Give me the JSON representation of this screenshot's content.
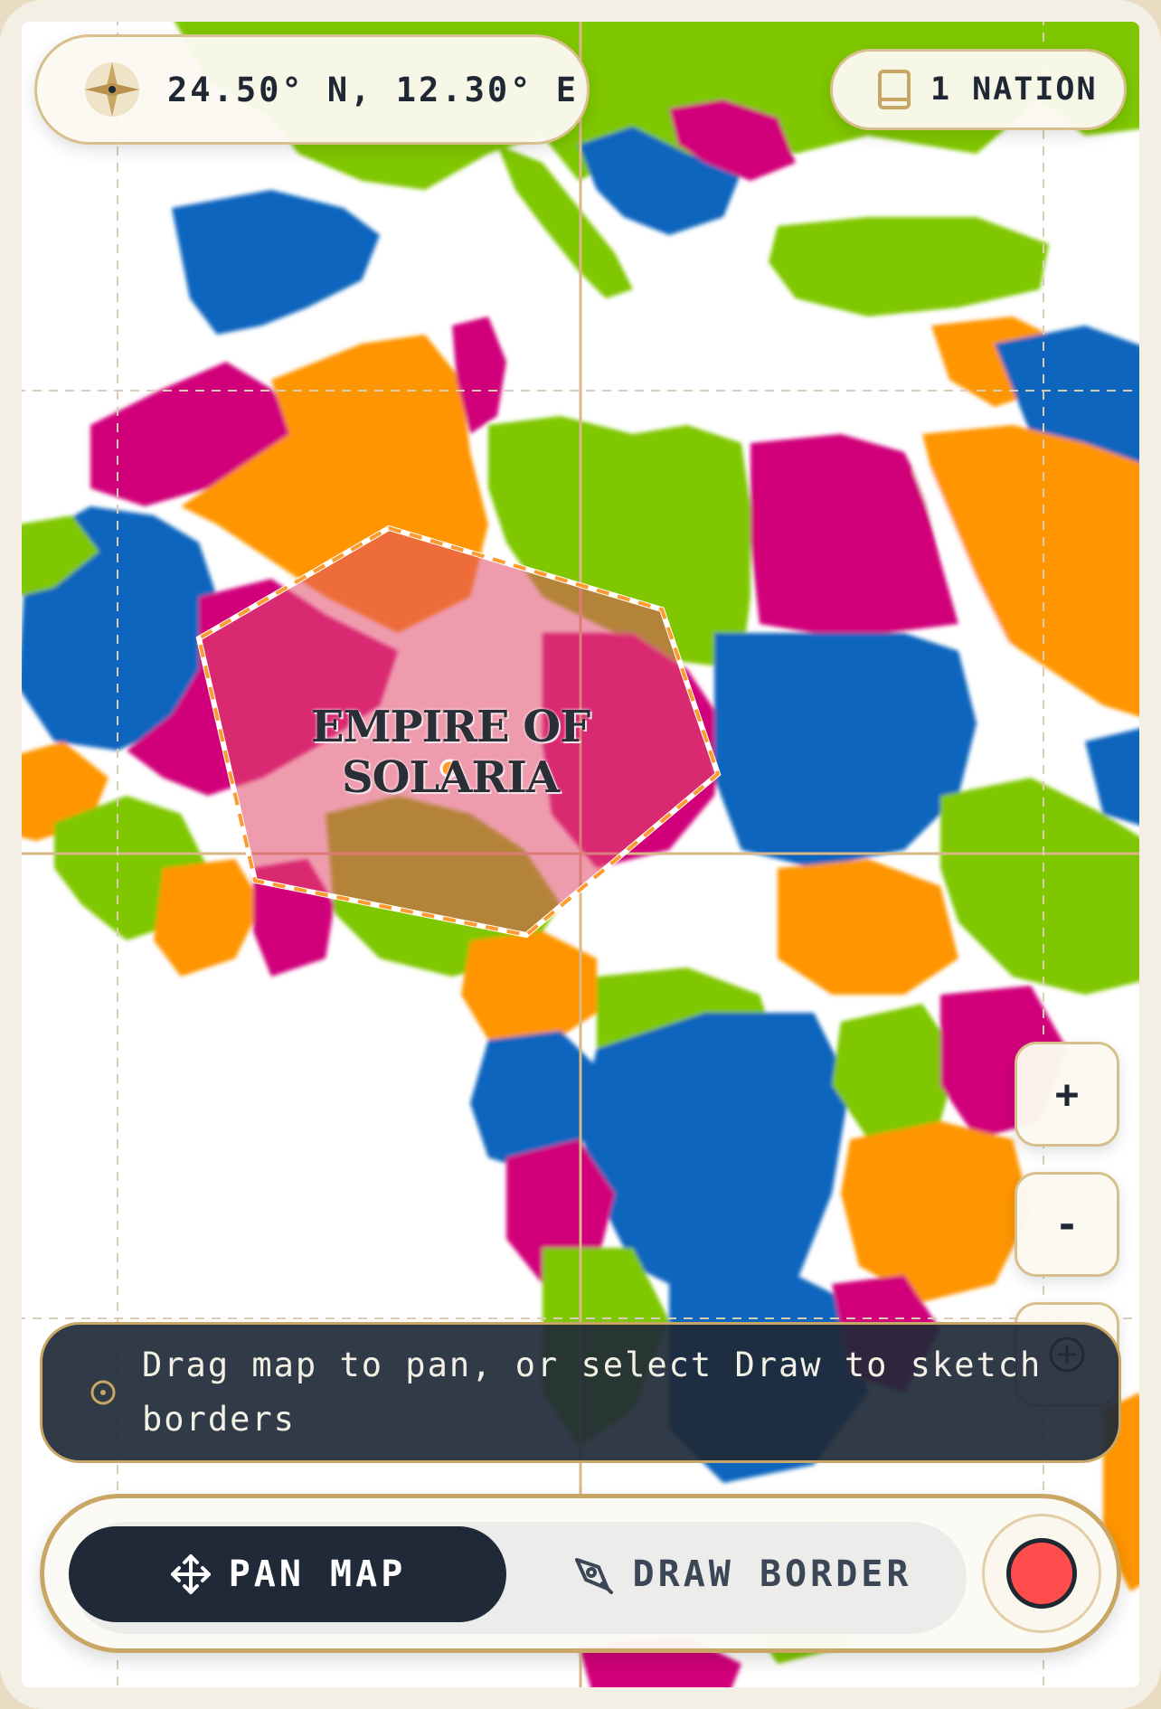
{
  "header": {
    "coordinates": "24.50° N, 12.30° E",
    "nation_count": "1 NATION"
  },
  "map": {
    "nation_label": "EMPIRE OF SOLARIA",
    "region_colors": [
      "#0765be",
      "#ff9500",
      "#7fc700",
      "#d1007a",
      "#ffffff"
    ],
    "border_color": "#ff9a2e",
    "fill_color": "#e04a6a"
  },
  "zoom": {
    "in_label": "+",
    "out_label": "-"
  },
  "hint": {
    "text": "Drag map to pan, or select Draw to sketch borders"
  },
  "toolbar": {
    "pan_label": "PAN MAP",
    "draw_label": "DRAW BORDER"
  },
  "colors": {
    "accent": "#c9a664",
    "dark": "#1f2937",
    "record": "#ff4d4d"
  },
  "icons": {
    "coordinates": "compass-icon",
    "nations": "book-icon",
    "hint": "info-icon",
    "pan": "move-icon",
    "draw": "pen-icon",
    "record": "record-icon"
  }
}
